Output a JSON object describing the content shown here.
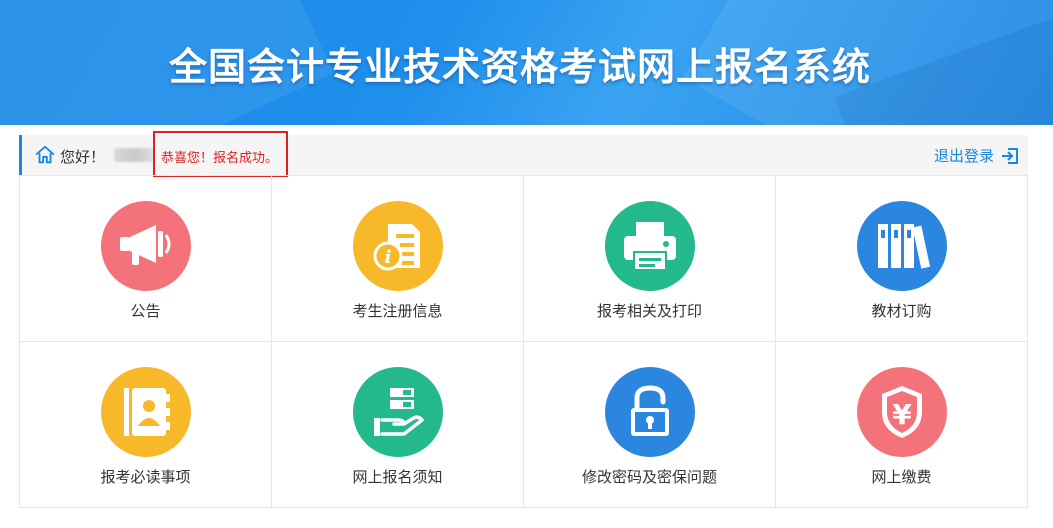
{
  "header": {
    "title": "全国会计专业技术资格考试网上报名系统"
  },
  "topbar": {
    "greeting": "您好！",
    "success_message": "恭喜您！报名成功。",
    "logout_label": "退出登录"
  },
  "tiles": [
    {
      "label": "公告",
      "icon": "megaphone-icon",
      "color": "#f4737a"
    },
    {
      "label": "考生注册信息",
      "icon": "info-document-icon",
      "color": "#f7b82a"
    },
    {
      "label": "报考相关及打印",
      "icon": "printer-icon",
      "color": "#23b98d"
    },
    {
      "label": "教材订购",
      "icon": "books-icon",
      "color": "#2b86e0"
    },
    {
      "label": "报考必读事项",
      "icon": "contact-book-icon",
      "color": "#f7b82a"
    },
    {
      "label": "网上报名须知",
      "icon": "hand-stack-icon",
      "color": "#23b98d"
    },
    {
      "label": "修改密码及密保问题",
      "icon": "lock-icon",
      "color": "#2b86e0"
    },
    {
      "label": "网上缴费",
      "icon": "yuan-shield-icon",
      "color": "#f4737a"
    }
  ]
}
